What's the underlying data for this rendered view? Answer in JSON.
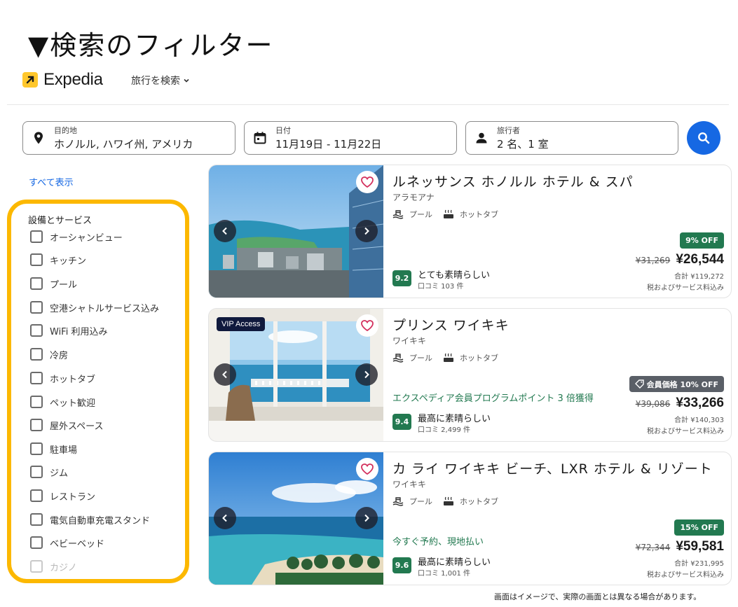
{
  "caption": "▼検索のフィルター",
  "header": {
    "brand": "Expedia",
    "nav_search": "旅行を検索",
    "nav_chevron": "chevron-down-icon"
  },
  "search": {
    "destination": {
      "label": "目的地",
      "value": "ホノルル, ハワイ州, アメリカ",
      "icon": "location-pin-icon"
    },
    "dates": {
      "label": "日付",
      "value": "11月19日 - 11月22日",
      "icon": "calendar-icon"
    },
    "travelers": {
      "label": "旅行者",
      "value": "2 名、1 室",
      "icon": "person-icon"
    },
    "button_icon": "search-icon",
    "accent_color": "#1668e3"
  },
  "sidebar": {
    "show_all": "すべて表示",
    "section_title": "設備とサービス",
    "highlight_color": "#fcb800",
    "filters": [
      {
        "label": "オーシャンビュー",
        "checked": false
      },
      {
        "label": "キッチン",
        "checked": false
      },
      {
        "label": "プール",
        "checked": false
      },
      {
        "label": "空港シャトルサービス込み",
        "checked": false
      },
      {
        "label": "WiFi 利用込み",
        "checked": false
      },
      {
        "label": "冷房",
        "checked": false
      },
      {
        "label": "ホットタブ",
        "checked": false
      },
      {
        "label": "ペット歓迎",
        "checked": false
      },
      {
        "label": "屋外スペース",
        "checked": false
      },
      {
        "label": "駐車場",
        "checked": false
      },
      {
        "label": "ジム",
        "checked": false
      },
      {
        "label": "レストラン",
        "checked": false
      },
      {
        "label": "電気自動車充電スタンド",
        "checked": false
      },
      {
        "label": "ベビーベッド",
        "checked": false
      },
      {
        "label": "カジノ",
        "checked": false
      }
    ]
  },
  "results": [
    {
      "name": "ルネッサンス ホノルル ホテル & スパ",
      "area": "アラモアナ",
      "amenities": [
        {
          "label": "プール",
          "icon": "pool-icon"
        },
        {
          "label": "ホットタブ",
          "icon": "hot-tub-icon"
        }
      ],
      "vip": "",
      "promo": "",
      "discount": "9% OFF",
      "discount_type": "percent",
      "old_price": "¥31,269",
      "price": "¥26,544",
      "total": "合計 ¥119,272",
      "tax_note": "税およびサービス料込み",
      "rating": "9.2",
      "rating_text": "とても素晴らしい",
      "reviews": "口コミ 103 件"
    },
    {
      "name": "プリンス ワイキキ",
      "area": "ワイキキ",
      "amenities": [
        {
          "label": "プール",
          "icon": "pool-icon"
        },
        {
          "label": "ホットタブ",
          "icon": "hot-tub-icon"
        }
      ],
      "vip": "VIP Access",
      "promo": "エクスペディア会員プログラムポイント 3 倍獲得",
      "discount": "会員価格 10% OFF",
      "discount_type": "member",
      "old_price": "¥39,086",
      "price": "¥33,266",
      "total": "合計 ¥140,303",
      "tax_note": "税およびサービス料込み",
      "rating": "9.4",
      "rating_text": "最高に素晴らしい",
      "reviews": "口コミ 2,499 件"
    },
    {
      "name": "カ ライ ワイキキ ビーチ、LXR ホテル & リゾート",
      "area": "ワイキキ",
      "amenities": [
        {
          "label": "プール",
          "icon": "pool-icon"
        },
        {
          "label": "ホットタブ",
          "icon": "hot-tub-icon"
        }
      ],
      "vip": "",
      "promo": "今すぐ予約、現地払い",
      "discount": "15% OFF",
      "discount_type": "percent",
      "old_price": "¥72,344",
      "price": "¥59,581",
      "total": "合計 ¥231,995",
      "tax_note": "税およびサービス料込み",
      "rating": "9.6",
      "rating_text": "最高に素晴らしい",
      "reviews": "口コミ 1,001 件"
    }
  ],
  "footnote": "画面はイメージで、実際の画面とは異なる場合があります。"
}
